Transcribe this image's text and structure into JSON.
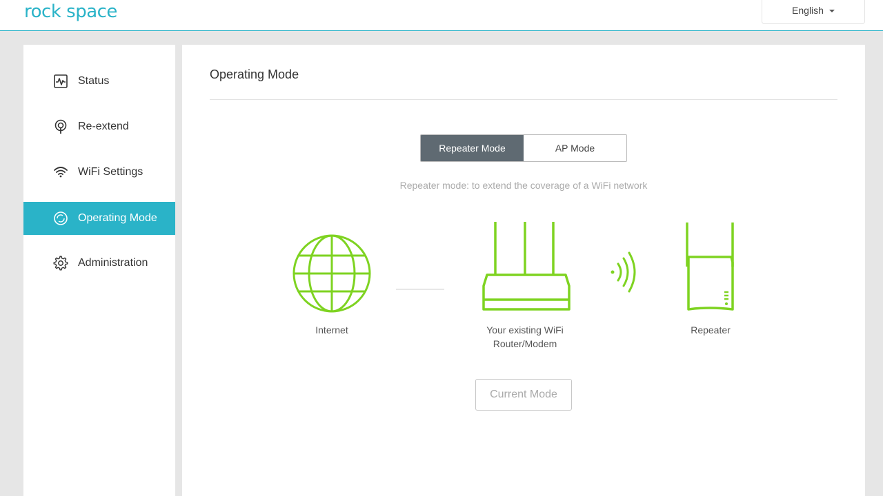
{
  "header": {
    "logo_text": "rock space",
    "language": "English"
  },
  "sidebar": {
    "items": [
      {
        "label": "Status",
        "icon": "pulse-icon"
      },
      {
        "label": "Re-extend",
        "icon": "antenna-icon"
      },
      {
        "label": "WiFi Settings",
        "icon": "wifi-icon"
      },
      {
        "label": "Operating Mode",
        "icon": "mode-icon",
        "active": true
      },
      {
        "label": "Administration",
        "icon": "gear-icon"
      }
    ]
  },
  "main": {
    "title": "Operating Mode",
    "modes": [
      "Repeater Mode",
      "AP Mode"
    ],
    "active_mode": "Repeater Mode",
    "description": "Repeater mode: to extend the coverage of a WiFi network",
    "diagram": {
      "internet_label": "Internet",
      "router_label_line1": "Your existing WiFi",
      "router_label_line2": "Router/Modem",
      "repeater_label": "Repeater"
    },
    "current_mode_button": "Current Mode"
  },
  "colors": {
    "accent": "#2ab3c8",
    "diagram_green": "#7ed321",
    "toggle_active": "#5f6a72"
  }
}
